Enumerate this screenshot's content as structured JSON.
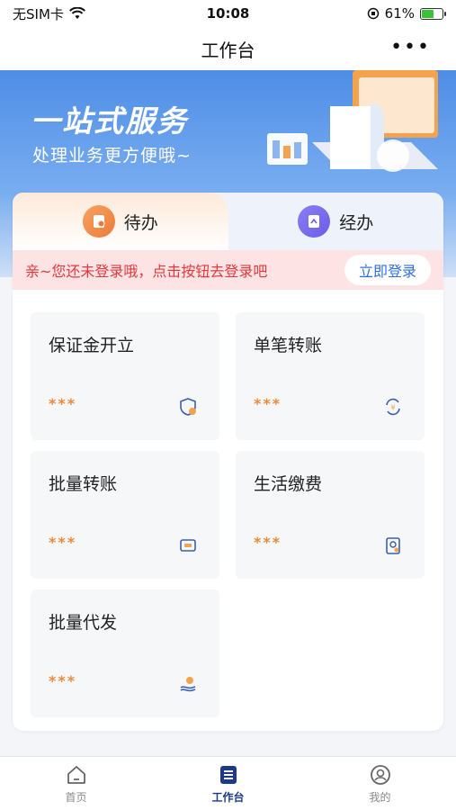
{
  "status_bar": {
    "carrier": "无SIM卡",
    "time": "10:08",
    "battery": "61%"
  },
  "nav": {
    "title": "工作台",
    "more": "•••"
  },
  "banner": {
    "title": "一站式服务",
    "subtitle": "处理业务更方便哦~"
  },
  "tabs": [
    {
      "label": "待办",
      "icon": "todo-icon",
      "active": true
    },
    {
      "label": "经办",
      "icon": "handled-icon",
      "active": false
    }
  ],
  "login_prompt": {
    "text": "亲~您还未登录哦，点击按钮去登录吧",
    "button": "立即登录"
  },
  "tiles": [
    {
      "title": "保证金开立",
      "value": "***",
      "icon": "deposit-icon"
    },
    {
      "title": "单笔转账",
      "value": "***",
      "icon": "transfer-icon"
    },
    {
      "title": "批量转账",
      "value": "***",
      "icon": "batch-transfer-icon"
    },
    {
      "title": "生活缴费",
      "value": "***",
      "icon": "bill-payment-icon"
    },
    {
      "title": "批量代发",
      "value": "***",
      "icon": "batch-payout-icon"
    }
  ],
  "tabbar": [
    {
      "label": "首页",
      "icon": "home-icon",
      "active": false
    },
    {
      "label": "工作台",
      "icon": "workbench-icon",
      "active": true
    },
    {
      "label": "我的",
      "icon": "profile-icon",
      "active": false
    }
  ],
  "colors": {
    "accent_blue": "#2f6fe0",
    "tabbar_active": "#1d3a8a",
    "warning_red": "#e0393e",
    "stars_orange": "#e98a3c"
  }
}
